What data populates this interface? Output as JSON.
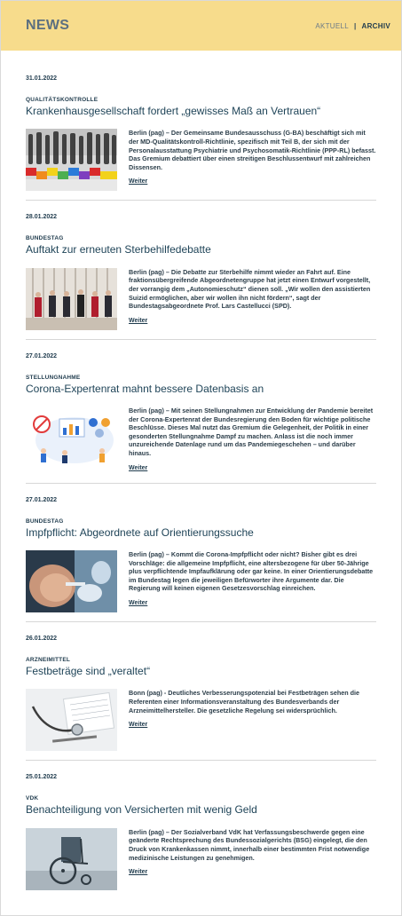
{
  "header": {
    "title": "NEWS",
    "nav_current": "AKTUELL",
    "nav_separator": "|",
    "nav_archive": "ARCHIV"
  },
  "articles": [
    {
      "date": "31.01.2022",
      "category": "QUALITÄTSKONTROLLE",
      "headline": "Krankenhausgesellschaft fordert „gewisses Maß an Vertrauen“",
      "teaser": "Berlin (pag) – Der Gemeinsame Bundesausschuss (G-BA) beschäftigt sich mit der MD-Qualitätskontroll-Richtlinie, spezifisch mit Teil B, der sich mit der Personalausstattung Psychiatrie und Psychosomatik-Richtlinie (PPP-RL) befasst. Das Gremium debattiert über einen streitigen Beschlussentwurf mit zahlreichen Dissensen.",
      "more": "Weiter",
      "image": "crowd-figures-photo"
    },
    {
      "date": "28.01.2022",
      "category": "BUNDESTAG",
      "headline": "Auftakt zur erneuten Sterbehilfedebatte",
      "teaser": "Berlin (pag) – Die Debatte zur Sterbehilfe nimmt wieder an Fahrt auf. Eine fraktionsübergreifende Abgeordnetengruppe hat jetzt einen Entwurf vorgestellt, der vorrangig dem „Autonomieschutz“ dienen soll. „Wir wollen den assistierten Suizid ermöglichen, aber wir wollen ihn nicht fördern“, sagt der Bundestagsabgeordnete Prof. Lars Castellucci (SPD).",
      "more": "Weiter",
      "image": "politicians-photo"
    },
    {
      "date": "27.01.2022",
      "category": "STELLUNGNAHME",
      "headline": "Corona-Expertenrat mahnt bessere Datenbasis an",
      "teaser": "Berlin (pag) – Mit seinen Stellungnahmen zur Entwicklung der Pandemie bereitet der Corona-Expertenrat der Bundesregierung den Boden für wichtige politische Beschlüsse. Dieses Mal nutzt das Gremium die Gelegenheit, der Politik in einer gesonderten Stellungnahme Dampf zu machen. Anlass ist die noch immer unzureichende Datenlage rund um das Pandemiegeschehen – und darüber hinaus.",
      "more": "Weiter",
      "image": "data-illustration"
    },
    {
      "date": "27.01.2022",
      "category": "BUNDESTAG",
      "headline": "Impfpflicht: Abgeordnete auf Orientierungssuche",
      "teaser": "Berlin (pag) – Kommt die Corona-Impfpflicht oder nicht? Bisher gibt es drei Vorschläge: die allgemeine Impfpflicht, eine altersbezogene für über 50-Jährige plus verpflichtende Impfaufklärung oder gar keine. In einer Orientierungsdebatte im Bundestag legen die jeweiligen Befürworter ihre Argumente dar. Die Regierung will keinen eigenen Gesetzesvorschlag einreichen.",
      "more": "Weiter",
      "image": "vaccination-photo"
    },
    {
      "date": "26.01.2022",
      "category": "ARZNEIMITTEL",
      "headline": "Festbeträge sind „veraltet“",
      "teaser": "Bonn (pag) - Deutliches Verbesserungspotenzial bei Festbeträgen sehen die Referenten einer Informationsveranstaltung des Bundesverbands der Arzneimittelhersteller. Die gesetzliche Regelung sei widersprüchlich.",
      "more": "Weiter",
      "image": "stethoscope-photo"
    },
    {
      "date": "25.01.2022",
      "category": "VDK",
      "headline": "Benachteiligung von Versicherten mit wenig Geld",
      "teaser": "Berlin (pag) – Der Sozialverband VdK hat Verfassungsbeschwerde gegen eine geänderte Rechtsprechung des Bundessozialgerichts (BSG) eingelegt, die den Druck von Krankenkassen nimmt, innerhalb einer bestimmten Frist notwendige medizinische Leistungen zu genehmigen.",
      "more": "Weiter",
      "image": "wheelchair-photo"
    }
  ]
}
